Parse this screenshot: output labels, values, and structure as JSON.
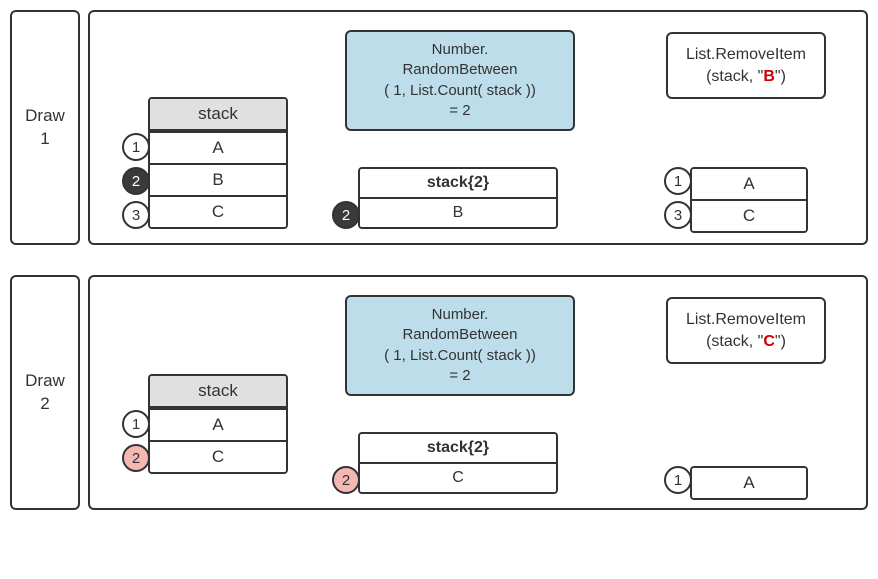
{
  "label1": {
    "word": "Draw",
    "num": "1"
  },
  "label2": {
    "word": "Draw",
    "num": "2"
  },
  "stack1": {
    "header": "stack",
    "rows": [
      "A",
      "B",
      "C"
    ],
    "badges": [
      "1",
      "2",
      "3"
    ]
  },
  "stack2": {
    "header": "stack",
    "rows": [
      "A",
      "C"
    ],
    "badges": [
      "1",
      "2"
    ]
  },
  "random1": {
    "line1": "Number.",
    "line2": "RandomBetween",
    "line3": "( 1,  List.Count( stack ))",
    "line4": "= 2"
  },
  "random2": {
    "line1": "Number.",
    "line2": "RandomBetween",
    "line3": "( 1,  List.Count( stack ))",
    "line4": "= 2"
  },
  "access1": {
    "expr": "stack{2}",
    "value": "B",
    "badge": "2"
  },
  "access2": {
    "expr": "stack{2}",
    "value": "C",
    "badge": "2"
  },
  "remove1": {
    "fn": "List.RemoveItem",
    "argPrefix": "(stack, \"",
    "argLetter": "B",
    "argSuffix": "\")"
  },
  "remove2": {
    "fn": "List.RemoveItem",
    "argPrefix": "(stack, \"",
    "argLetter": "C",
    "argSuffix": "\")"
  },
  "result1": {
    "rows": [
      "A",
      "C"
    ],
    "badges": [
      "1",
      "3"
    ]
  },
  "result2": {
    "rows": [
      "A"
    ],
    "badges": [
      "1"
    ]
  }
}
